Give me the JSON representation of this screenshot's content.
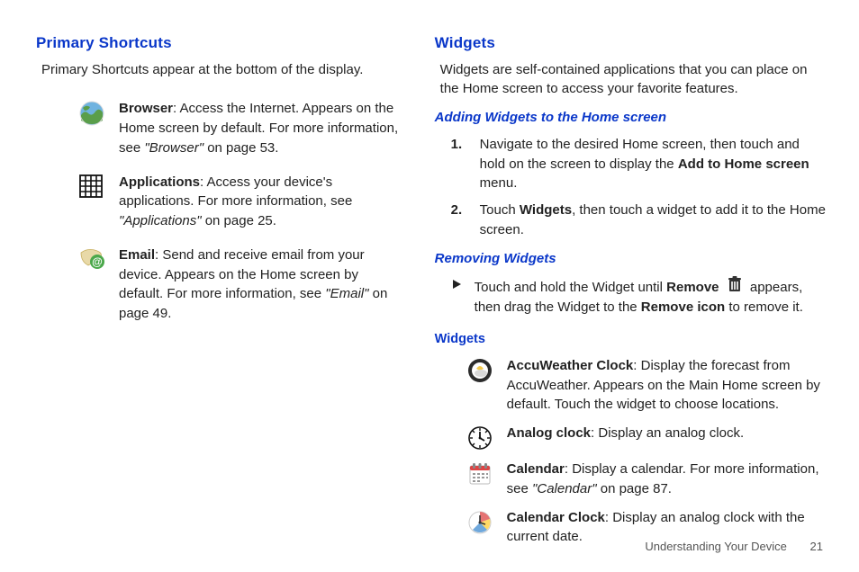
{
  "left": {
    "heading": "Primary Shortcuts",
    "intro": "Primary Shortcuts appear at the bottom of the display.",
    "items": [
      {
        "bold": "Browser",
        "rest": ": Access the Internet. Appears on the Home screen by default. For more information, see ",
        "ref": "\"Browser\"",
        "pageRef": " on page 53."
      },
      {
        "bold": "Applications",
        "rest": ": Access your device's applications. For more information, see ",
        "ref": "\"Applications\"",
        "pageRef": " on page 25."
      },
      {
        "bold": "Email",
        "rest": ": Send and receive email from your device. Appears on the Home screen by default. For more information, see ",
        "ref": "\"Email\"",
        "pageRef": " on page 49."
      }
    ]
  },
  "right": {
    "heading": "Widgets",
    "intro": "Widgets are self-contained applications that you can place on the Home screen to access your favorite features.",
    "addHeading": "Adding Widgets to the Home screen",
    "steps": [
      {
        "n": "1.",
        "pre": "Navigate to the desired Home screen, then touch and hold on the screen to display the ",
        "b": "Add to Home screen",
        "post": " menu."
      },
      {
        "n": "2.",
        "pre": "Touch ",
        "b": "Widgets",
        "post": ", then touch a widget to add it to the Home screen."
      }
    ],
    "removeHeading": "Removing Widgets",
    "remove": {
      "pre": "Touch and hold the Widget until ",
      "b1": "Remove",
      "mid": " appears, then drag the Widget to the ",
      "b2": "Remove icon",
      "post": " to remove it."
    },
    "listHeading": "Widgets",
    "list": [
      {
        "bold": "AccuWeather Clock",
        "rest": ": Display the forecast from AccuWeather. Appears on the Main Home screen by default. Touch the widget to choose locations."
      },
      {
        "bold": "Analog clock",
        "rest": ": Display an analog clock."
      },
      {
        "bold": "Calendar",
        "rest": ": Display a calendar. For more information, see ",
        "ref": "\"Calendar\"",
        "pageRef": " on page 87."
      },
      {
        "bold": "Calendar Clock",
        "rest": ": Display an analog clock with the current date."
      }
    ]
  },
  "footer": {
    "section": "Understanding Your Device",
    "page": "21"
  }
}
